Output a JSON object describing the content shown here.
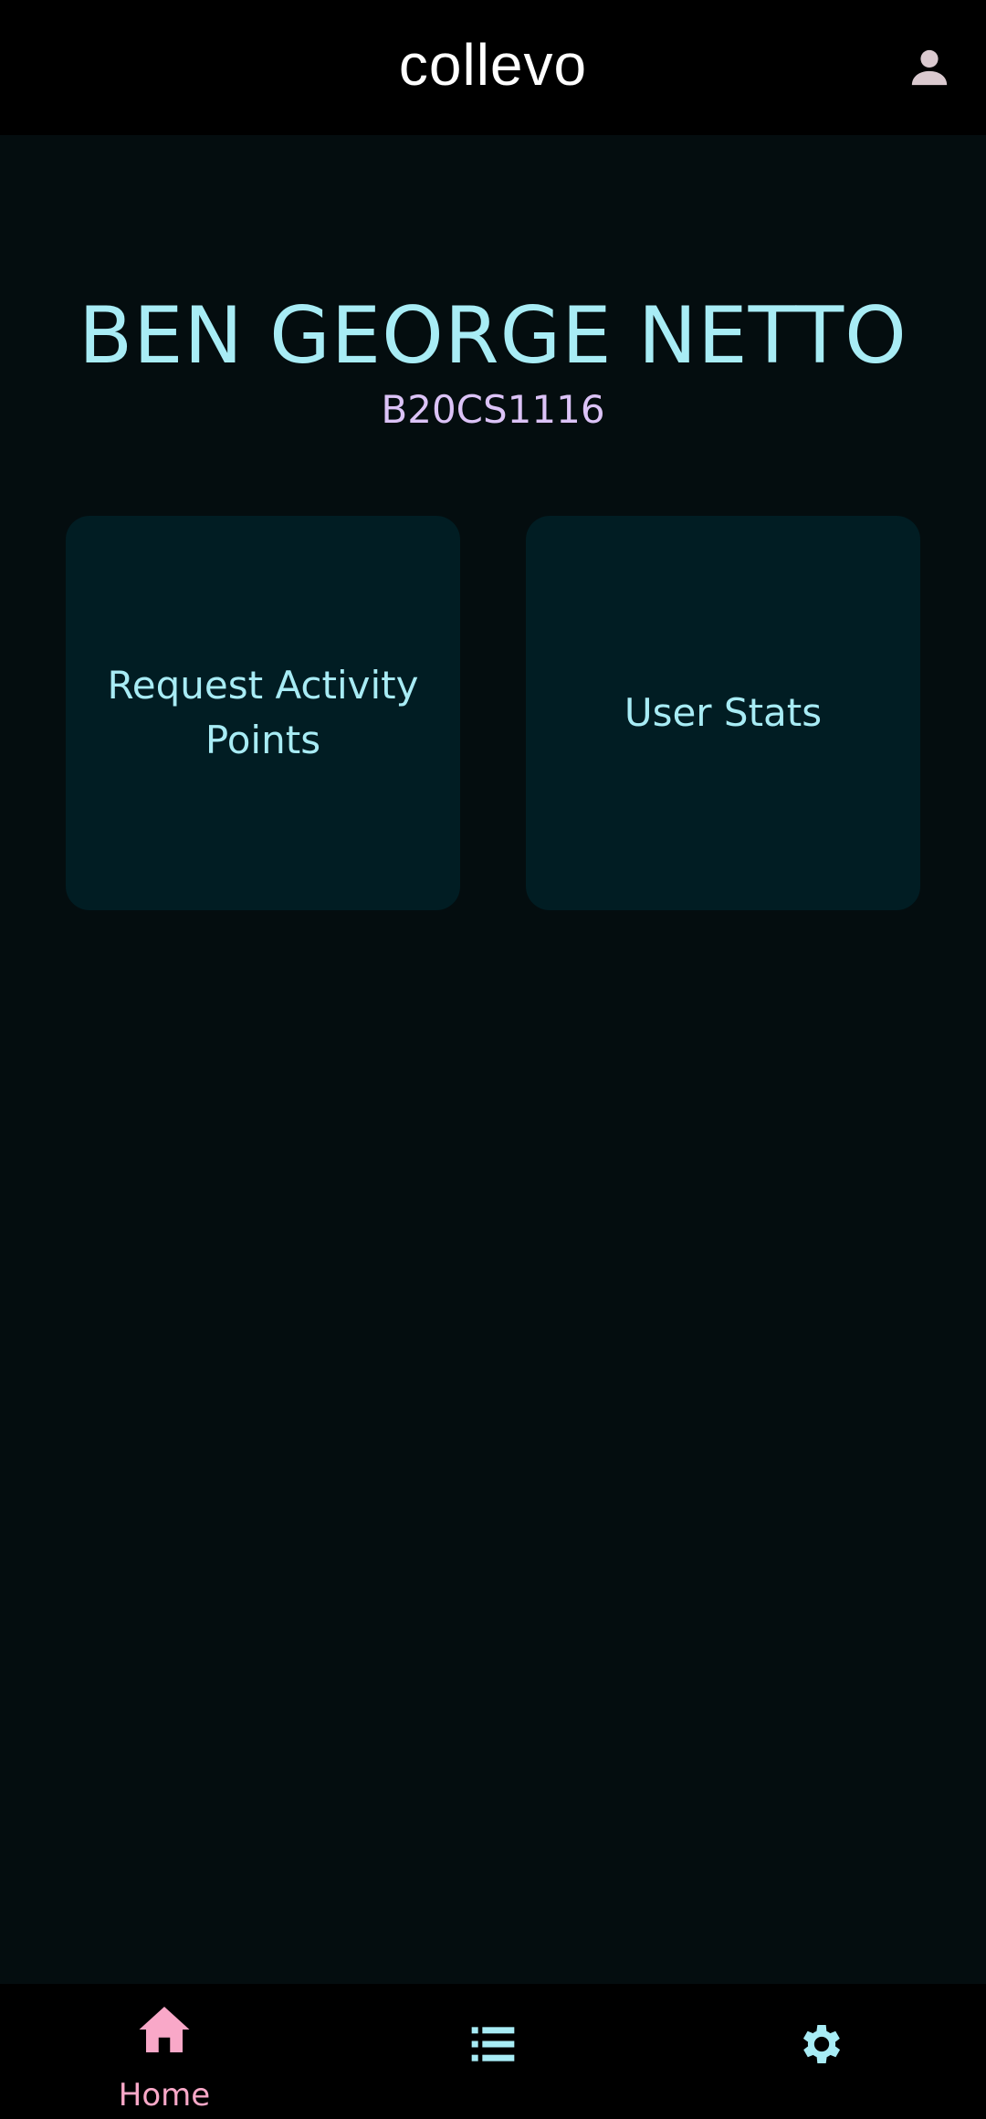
{
  "header": {
    "brand": "collevo",
    "profile_icon": "person-icon"
  },
  "user": {
    "name": "BEN GEORGE NETTO",
    "id": "B20CS1116"
  },
  "cards": [
    {
      "label": "Request Activity Points"
    },
    {
      "label": "User Stats"
    }
  ],
  "bottom_nav": {
    "items": [
      {
        "label": "Home",
        "icon": "home-icon",
        "active": true
      },
      {
        "label": "",
        "icon": "list-icon",
        "active": false
      },
      {
        "label": "",
        "icon": "gear-icon",
        "active": false
      }
    ]
  },
  "colors": {
    "background": "#040d0f",
    "bar": "#000000",
    "card": "#011d23",
    "primary_text": "#a8ecf5",
    "secondary_text": "#dcc3f7",
    "active_nav": "#f9a8c8",
    "inactive_nav": "#a8ecf5"
  }
}
